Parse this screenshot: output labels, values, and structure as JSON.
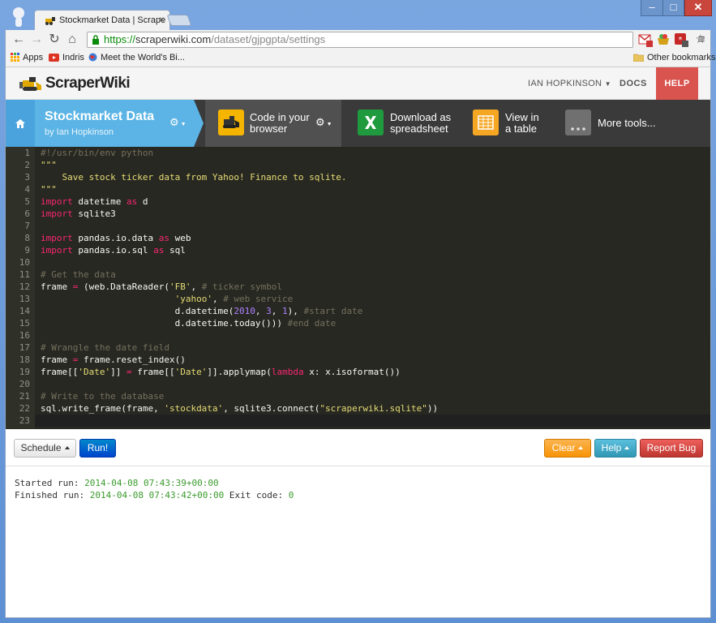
{
  "browser": {
    "tab_title": "Stockmarket Data | Scrape",
    "close_glyph": "×",
    "url_https": "https://",
    "url_host": "scraperwiki.com",
    "url_path": "/dataset/gjpgpta/settings",
    "window_min": "–",
    "window_max": "□",
    "window_close": "✕",
    "bookmarks": [
      {
        "label": "Apps",
        "icon": "apps-grid-icon"
      },
      {
        "label": "Indris",
        "icon": "youtube-icon"
      },
      {
        "label": "Meet the World's Bi...",
        "icon": "globe-icon"
      }
    ],
    "other_bookmarks": "Other bookmarks"
  },
  "site": {
    "logo": "ScraperWiki",
    "user": "IAN HOPKINSON",
    "docs": "DOCS",
    "help": "HELP"
  },
  "dataset": {
    "title": "Stockmarket Data",
    "byline": "by Ian Hopkinson"
  },
  "tools": [
    {
      "line1": "Code in your",
      "line2": "browser",
      "icon": "bulldozer-icon"
    },
    {
      "line1": "Download as",
      "line2": "spreadsheet",
      "icon": "excel-icon"
    },
    {
      "line1": "View in",
      "line2": "a table",
      "icon": "table-grid-icon"
    },
    {
      "line1": "More tools...",
      "line2": "",
      "icon": "more-dots-icon"
    }
  ],
  "editor": {
    "line_numbers": [
      "1",
      "2",
      "3",
      "4",
      "5",
      "6",
      "7",
      "8",
      "9",
      "10",
      "11",
      "12",
      "13",
      "14",
      "15",
      "16",
      "17",
      "18",
      "19",
      "20",
      "21",
      "22",
      "23"
    ],
    "code_lines": [
      [
        {
          "t": "#!/usr/bin/env python",
          "c": "cm"
        }
      ],
      [
        {
          "t": "\"\"\"",
          "c": "str"
        }
      ],
      [
        {
          "t": "    Save stock ticker data from Yahoo! Finance to sqlite.",
          "c": "str"
        }
      ],
      [
        {
          "t": "\"\"\"",
          "c": "str"
        }
      ],
      [
        {
          "t": "import",
          "c": "kw"
        },
        {
          "t": " datetime "
        },
        {
          "t": "as",
          "c": "kw"
        },
        {
          "t": " d"
        }
      ],
      [
        {
          "t": "import",
          "c": "kw"
        },
        {
          "t": " sqlite3"
        }
      ],
      [],
      [
        {
          "t": "import",
          "c": "kw"
        },
        {
          "t": " pandas.io.data "
        },
        {
          "t": "as",
          "c": "kw"
        },
        {
          "t": " web"
        }
      ],
      [
        {
          "t": "import",
          "c": "kw"
        },
        {
          "t": " pandas.io.sql "
        },
        {
          "t": "as",
          "c": "kw"
        },
        {
          "t": " sql"
        }
      ],
      [],
      [
        {
          "t": "# Get the data",
          "c": "cm"
        }
      ],
      [
        {
          "t": "frame "
        },
        {
          "t": "=",
          "c": "kw"
        },
        {
          "t": " (web.DataReader("
        },
        {
          "t": "'FB'",
          "c": "str"
        },
        {
          "t": ", "
        },
        {
          "t": "# ticker symbol",
          "c": "cm"
        }
      ],
      [
        {
          "t": "                         "
        },
        {
          "t": "'yahoo'",
          "c": "str"
        },
        {
          "t": ", "
        },
        {
          "t": "# web service",
          "c": "cm"
        }
      ],
      [
        {
          "t": "                         d.datetime("
        },
        {
          "t": "2010",
          "c": "num"
        },
        {
          "t": ", "
        },
        {
          "t": "3",
          "c": "num"
        },
        {
          "t": ", "
        },
        {
          "t": "1",
          "c": "num"
        },
        {
          "t": "), "
        },
        {
          "t": "#start date",
          "c": "cm"
        }
      ],
      [
        {
          "t": "                         d.datetime.today())) "
        },
        {
          "t": "#end date",
          "c": "cm"
        }
      ],
      [],
      [
        {
          "t": "# Wrangle the date field",
          "c": "cm"
        }
      ],
      [
        {
          "t": "frame "
        },
        {
          "t": "=",
          "c": "kw"
        },
        {
          "t": " frame.reset_index()"
        }
      ],
      [
        {
          "t": "frame[["
        },
        {
          "t": "'Date'",
          "c": "str"
        },
        {
          "t": "]] "
        },
        {
          "t": "=",
          "c": "kw"
        },
        {
          "t": " frame[["
        },
        {
          "t": "'Date'",
          "c": "str"
        },
        {
          "t": "]].applymap("
        },
        {
          "t": "lambda",
          "c": "kw"
        },
        {
          "t": " x: x.isoformat())"
        }
      ],
      [],
      [
        {
          "t": "# Write to the database",
          "c": "cm"
        }
      ],
      [
        {
          "t": "sql.write_frame(frame, "
        },
        {
          "t": "'stockdata'",
          "c": "str"
        },
        {
          "t": ", sqlite3.connect("
        },
        {
          "t": "\"scraperwiki.sqlite\"",
          "c": "str"
        },
        {
          "t": "))"
        }
      ],
      []
    ]
  },
  "actions": {
    "schedule": "Schedule",
    "run": "Run!",
    "clear": "Clear",
    "help": "Help",
    "report_bug": "Report Bug"
  },
  "console": {
    "started_label": "Started run: ",
    "started_time": "2014-04-08 07:43:39+00:00",
    "finished_label": "Finished run: ",
    "finished_time": "2014-04-08 07:43:42+00:00",
    "exit_label": " Exit code: ",
    "exit_code": "0"
  },
  "colors": {
    "accent_blue": "#5bb4e5",
    "editor_bg": "#272822",
    "help_red": "#d9534f",
    "success_green": "#3c9a2e"
  }
}
